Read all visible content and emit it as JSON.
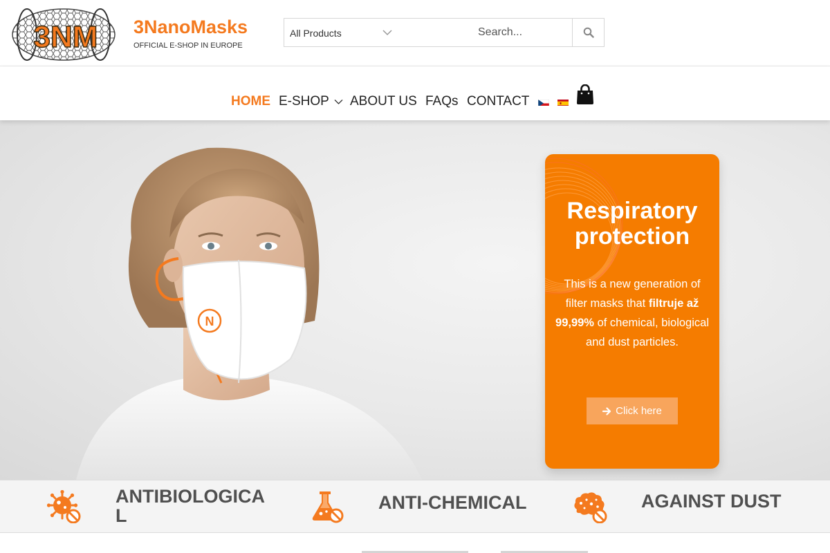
{
  "brand": {
    "name": "3NanoMasks",
    "tagline": "OFFICIAL E-SHOP IN EUROPE",
    "logo_text": "3NM",
    "accent_color": "#f47a1f"
  },
  "search": {
    "category_value": "All Products",
    "placeholder": "Search...",
    "button_icon": "search-icon"
  },
  "nav": {
    "items": [
      {
        "label": "HOME",
        "active": true
      },
      {
        "label": "E-SHOP",
        "active": false,
        "has_dropdown": true
      },
      {
        "label": "ABOUT US",
        "active": false
      },
      {
        "label": "FAQs",
        "active": false
      },
      {
        "label": "CONTACT",
        "active": false
      }
    ],
    "languages": [
      "cs-flag-icon",
      "es-flag-icon"
    ],
    "cart_icon": "shopping-bag-icon"
  },
  "hero": {
    "card": {
      "title_line1": "Respiratory",
      "title_line2": "protection",
      "text_pre": "This is a new generation of filter masks that ",
      "text_bold": "filtruje až 99,99%",
      "text_post": " of chemical, biological and dust particles.",
      "button_label": "Click here",
      "button_icon": "arrow-right-icon",
      "card_color": "#f57c00"
    },
    "mask_logo_text": "N"
  },
  "features": [
    {
      "label_line1": "ANTIBIOLOGICA",
      "label_line2": "L",
      "icon": "virus-blocked-icon"
    },
    {
      "label_line1": "ANTI-CHEMICAL",
      "label_line2": "",
      "icon": "flask-blocked-icon"
    },
    {
      "label_line1": "AGAINST DUST",
      "label_line2": "",
      "icon": "dust-cloud-blocked-icon"
    }
  ]
}
